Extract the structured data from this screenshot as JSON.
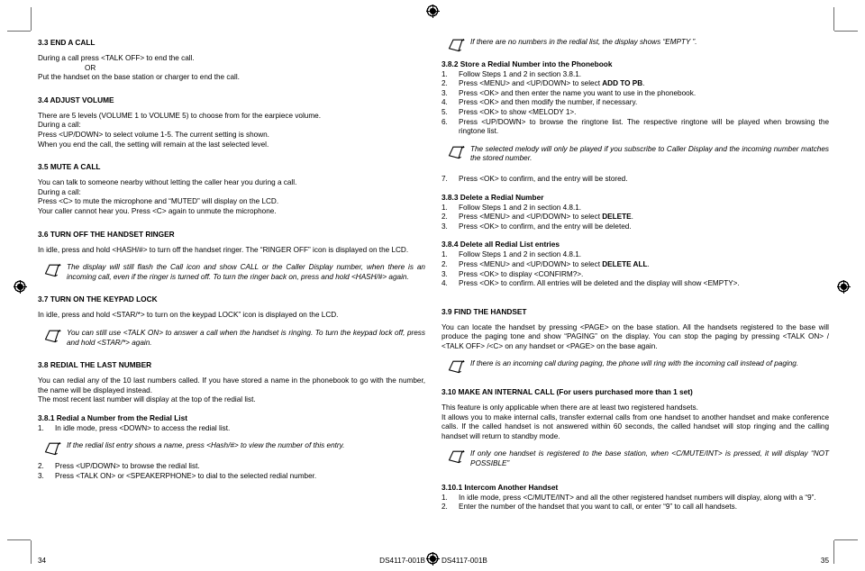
{
  "document": {
    "type": "user-manual-spread",
    "doc_code": "DS4117-001B"
  },
  "left_page": {
    "page_number": "34",
    "footer_code": "DS4117-001B",
    "sections": [
      {
        "heading": "3.3 END A CALL",
        "lines": [
          "During a call press <TALK OFF> to end the call.",
          "OR",
          "Put the handset on the base station or charger to end the call."
        ]
      },
      {
        "heading": "3.4 ADJUST VOLUME",
        "lines": [
          "There are 5 levels (VOLUME 1 to VOLUME 5) to choose from for the earpiece volume.",
          "During a call:",
          "Press <UP/DOWN> to select volume 1-5. The current setting is shown.",
          "When you end the call, the setting will remain at the last selected level."
        ]
      },
      {
        "heading": "3.5 MUTE A CALL",
        "lines": [
          "You can talk to someone nearby without letting the caller hear you during a call.",
          "During a call:",
          "Press <C> to mute the microphone and “MUTED” will display on the LCD.",
          "Your caller cannot hear you. Press <C> again to unmute the microphone."
        ]
      },
      {
        "heading": "3.6 TURN OFF THE HANDSET RINGER",
        "body": "In idle, press and hold <HASH/#> to turn off the handset ringer. The “RINGER OFF” icon is displayed on the LCD.",
        "note": "The display will still flash the Call icon and show CALL or the Caller Display number, when there is an incoming call, even if the ringer is turned off. To turn the ringer back on, press and hold <HASH/#> again."
      },
      {
        "heading": "3.7 TURN ON THE KEYPAD LOCK",
        "body": "In idle, press and hold <STAR/*> to turn on the keypad LOCK” icon is displayed on the LCD.",
        "note": "You can still use <TALK ON> to answer a call when the handset is ringing. To turn the keypad lock off, press and hold <STAR/*> again."
      },
      {
        "heading": "3.8 REDIAL THE LAST NUMBER",
        "lines": [
          "You can redial any of the 10 last numbers called. If you have stored a name in the phonebook to go with the number, the name will be displayed instead.",
          "The most recent last number will display at the top of the redial list."
        ]
      }
    ],
    "subsection": {
      "heading": "3.8.1 Redial a Number from the Redial List",
      "step1": {
        "num": "1.",
        "text": "In idle mode, press <DOWN> to access the redial list."
      },
      "note": "If the redial list entry shows a name, press <Hash/#> to view the number of this entry.",
      "steps_after": [
        {
          "num": "2.",
          "text": "Press <UP/DOWN> to browse the redial list."
        },
        {
          "num": "3.",
          "text": "Press <TALK ON> or <SPEAKERPHONE> to dial to the selected redial number."
        }
      ]
    }
  },
  "right_page": {
    "page_number": "35",
    "footer_code": "DS4117-001B",
    "top_note": "If there are no numbers in the redial list, the display shows “EMPTY ”.",
    "sections": [
      {
        "heading": "3.8.2 Store a Redial Number into the Phonebook",
        "steps": [
          {
            "num": "1.",
            "pre": "Follow Steps 1 and 2 in section 3.8.1.",
            "bold": "",
            "post": ""
          },
          {
            "num": "2.",
            "pre": "Press <MENU> and <UP/DOWN> to select ",
            "bold": "ADD TO PB",
            "post": "."
          },
          {
            "num": "3.",
            "pre": "Press <OK> and then enter the name you want to use in the phonebook.",
            "bold": "",
            "post": ""
          },
          {
            "num": "4.",
            "pre": "Press <OK> and then modify the number, if necessary.",
            "bold": "",
            "post": ""
          },
          {
            "num": "5.",
            "pre": "Press <OK> to show <MELODY 1>.",
            "bold": "",
            "post": ""
          },
          {
            "num": "6.",
            "pre": "Press <UP/DOWN> to browse the ringtone list. The respective ringtone will be played when browsing the ringtone list.",
            "bold": "",
            "post": ""
          }
        ],
        "note": "The selected melody will only be played if you subscribe to Caller Display and the incoming number matches the stored number.",
        "steps_after": [
          {
            "num": "7.",
            "pre": "Press <OK> to confirm, and the entry will be stored.",
            "bold": "",
            "post": ""
          }
        ]
      },
      {
        "heading": "3.8.3 Delete a Redial Number",
        "steps": [
          {
            "num": "1.",
            "pre": "Follow Steps 1 and 2 in section 4.8.1.",
            "bold": "",
            "post": ""
          },
          {
            "num": "2.",
            "pre": "Press <MENU> and <UP/DOWN> to select ",
            "bold": "DELETE",
            "post": "."
          },
          {
            "num": "3.",
            "pre": "Press <OK> to confirm, and the entry will be deleted.",
            "bold": "",
            "post": ""
          }
        ]
      },
      {
        "heading": "3.8.4 Delete all Redial List entries",
        "steps": [
          {
            "num": "1.",
            "pre": "Follow Steps 1 and 2 in section 4.8.1.",
            "bold": "",
            "post": ""
          },
          {
            "num": "2.",
            "pre": "Press <MENU> and <UP/DOWN> to select ",
            "bold": "DELETE ALL",
            "post": "."
          },
          {
            "num": "3.",
            "pre": " Press <OK> to display <CONFIRM?>.",
            "bold": "",
            "post": ""
          },
          {
            "num": "4.",
            "pre": "Press <OK> to confirm. All entries will be deleted and the display will show <EMPTY>.",
            "bold": "",
            "post": ""
          }
        ]
      },
      {
        "heading": "3.9 FIND THE HANDSET",
        "body": "You can locate the handset by pressing <PAGE> on the base station. All the handsets registered to the base will produce the paging tone and show “PAGING” on the display. You can stop the paging by pressing <TALK ON> / <TALK OFF> /<C> on any handset or <PAGE> on the base again.",
        "note": "If there is an incoming call during paging, the phone will ring with the incoming call instead of paging."
      },
      {
        "heading": "3.10  MAKE AN INTERNAL CALL (For users purchased more than 1 set)",
        "lines": [
          "This feature is only applicable when there are at least two registered handsets.",
          "It allows you to make internal calls, transfer external calls from one handset to another handset and make conference calls. If the called handset is not answered within 60 seconds, the called handset will stop ringing and the calling handset will return to standby mode."
        ],
        "note": "If only one handset is registered to the base station, when <C/MUTE/INT> is pressed, it will display “NOT POSSIBLE”"
      }
    ],
    "subsection": {
      "heading": "3.10.1 Intercom Another Handset",
      "steps": [
        {
          "num": "1.",
          "text": "In idle mode, press <C/MUTE/INT> and all the other registered handset numbers will display, along with a “9”."
        },
        {
          "num": "2.",
          "text": "Enter the number of the handset that you want to call, or enter “9” to call all handsets."
        }
      ]
    }
  },
  "marks": {
    "registration_icon": "registration-target-icon",
    "crop_icon": "crop-mark-icon"
  }
}
